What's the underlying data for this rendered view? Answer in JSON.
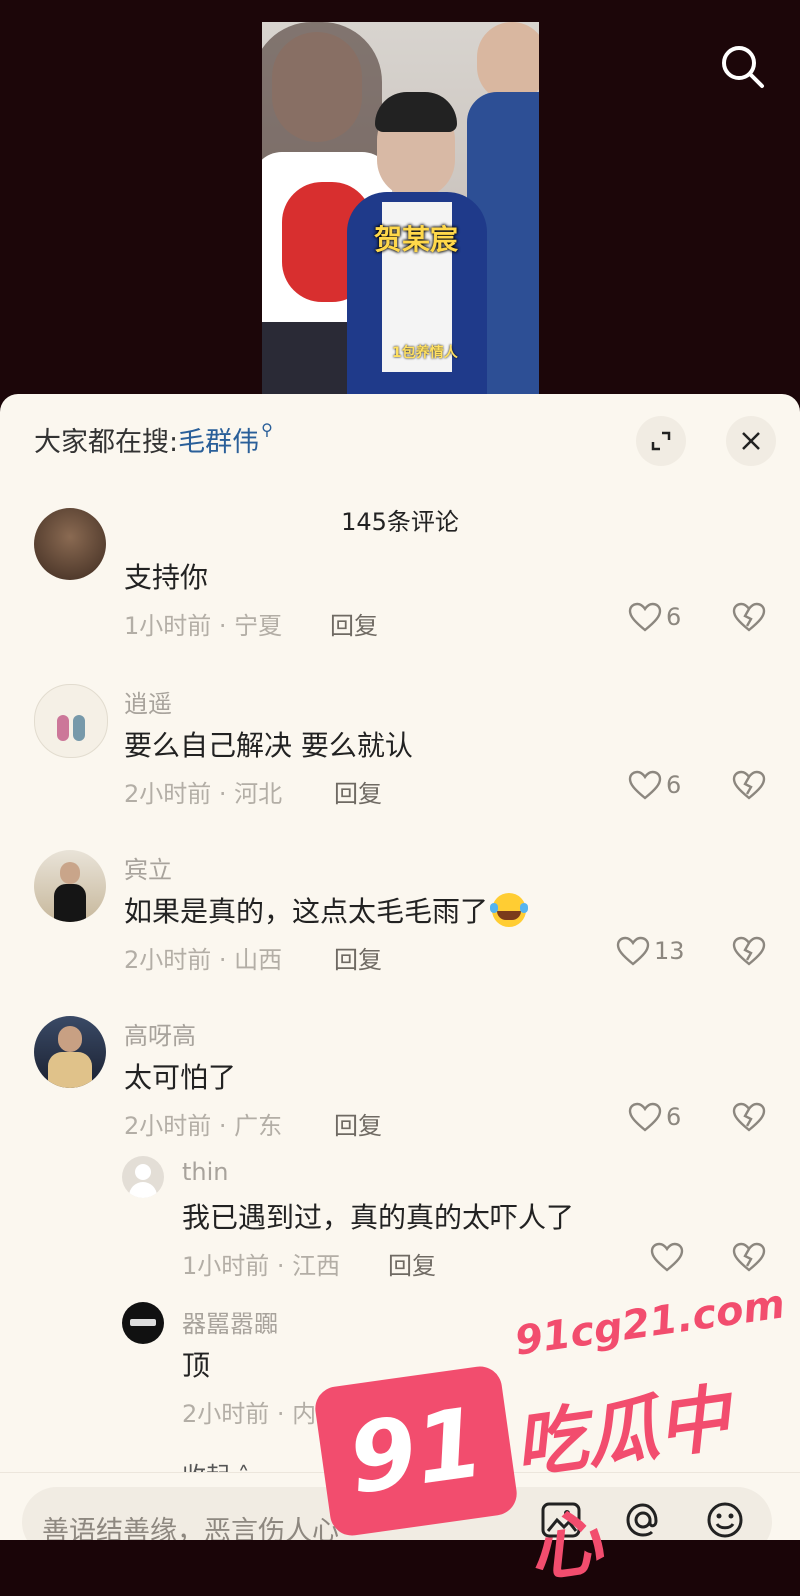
{
  "video": {
    "caption_name": "贺某宸",
    "caption_small": "1包养情人"
  },
  "trending": {
    "prefix": "大家都在搜:",
    "keyword": "毛群伟"
  },
  "comment_count": "145条评论",
  "comments": [
    {
      "user": "",
      "text": "支持你",
      "time": "1小时前 · 宁夏",
      "reply": "回复",
      "likes": "6"
    },
    {
      "user": "逍遥",
      "text": "要么自己解决 要么就认",
      "time": "2小时前 · 河北",
      "reply": "回复",
      "likes": "6"
    },
    {
      "user": "宾立",
      "text": "如果是真的，这点太毛毛雨了",
      "time": "2小时前 · 山西",
      "reply": "回复",
      "likes": "13"
    },
    {
      "user": "高呀高",
      "text": "太可怕了",
      "time": "2小时前 · 广东",
      "reply": "回复",
      "likes": "6"
    }
  ],
  "replies": [
    {
      "user": "thin",
      "text": "我已遇到过，真的真的太吓人了",
      "time": "1小时前 · 江西",
      "reply": "回复",
      "likes": ""
    },
    {
      "user": "器嚚嚣嚻",
      "text": "顶",
      "time": "2小时前 · 内蒙古",
      "reply": "回复",
      "likes": ""
    }
  ],
  "collapse_label": "收起 ˄",
  "input_placeholder": "善语结善缘，恶言伤人心",
  "watermark": {
    "big": "91",
    "url": "91cg21.com",
    "cn": "吃瓜中心"
  },
  "colors": {
    "sheet": "#fbf7ef",
    "keyword": "#2a5f99",
    "watermark": "#f24d6e"
  }
}
